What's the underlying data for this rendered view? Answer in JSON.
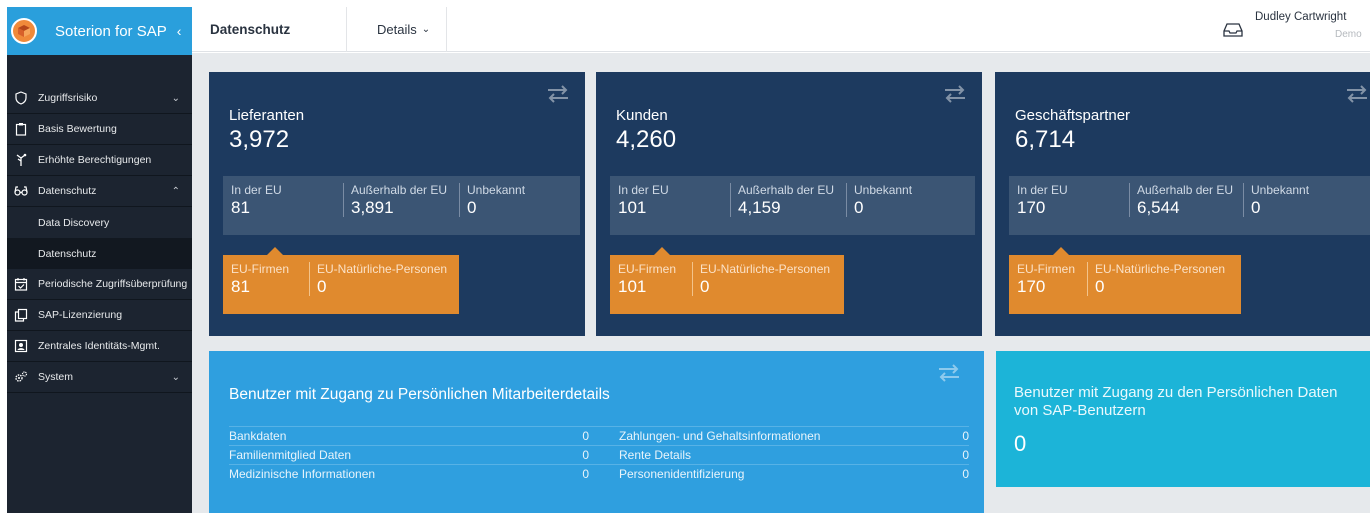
{
  "app": {
    "title": "Soterion for SAP",
    "collapse_glyph": "‹"
  },
  "sidebar": {
    "items": [
      {
        "label": "Zugriffsrisiko",
        "icon": "shield-icon",
        "arrow": "⌄"
      },
      {
        "label": "Basis Bewertung",
        "icon": "clipboard-icon"
      },
      {
        "label": "Erhöhte Berechtigungen",
        "icon": "tree-icon"
      },
      {
        "label": "Datenschutz",
        "icon": "glasses-icon",
        "arrow": "⌃"
      },
      {
        "label": "Periodische Zugriffsüberprüfung",
        "icon": "calendar-check-icon"
      },
      {
        "label": "SAP-Lizenzierung",
        "icon": "copy-icon"
      },
      {
        "label": "Zentrales Identitäts-Mgmt.",
        "icon": "id-card-icon"
      },
      {
        "label": "System",
        "icon": "gears-icon",
        "arrow": "⌄"
      }
    ],
    "subitems": [
      {
        "label": "Data Discovery"
      },
      {
        "label": "Datenschutz"
      }
    ]
  },
  "topbar": {
    "title": "Datenschutz",
    "details_label": "Details",
    "details_chevron": "⌄",
    "user_name": "Dudley Cartwright",
    "user_role": "Demo"
  },
  "cards": [
    {
      "label": "Lieferanten",
      "total": "3,972",
      "in_eu_label": "In der EU",
      "in_eu": "81",
      "outside_eu_label": "Außerhalb der EU",
      "outside_eu": "3,891",
      "unknown_label": "Unbekannt",
      "unknown": "0",
      "eu_firms_label": "EU-Firmen",
      "eu_firms": "81",
      "eu_persons_label": "EU-Natürliche-Personen",
      "eu_persons": "0"
    },
    {
      "label": "Kunden",
      "total": "4,260",
      "in_eu_label": "In der EU",
      "in_eu": "101",
      "outside_eu_label": "Außerhalb der EU",
      "outside_eu": "4,159",
      "unknown_label": "Unbekannt",
      "unknown": "0",
      "eu_firms_label": "EU-Firmen",
      "eu_firms": "101",
      "eu_persons_label": "EU-Natürliche-Personen",
      "eu_persons": "0"
    },
    {
      "label": "Geschäftspartner",
      "total": "6,714",
      "in_eu_label": "In der EU",
      "in_eu": "170",
      "outside_eu_label": "Außerhalb der EU",
      "outside_eu": "6,544",
      "unknown_label": "Unbekannt",
      "unknown": "0",
      "eu_firms_label": "EU-Firmen",
      "eu_firms": "170",
      "eu_persons_label": "EU-Natürliche-Personen",
      "eu_persons": "0"
    }
  ],
  "employee_panel": {
    "title": "Benutzer mit Zugang zu Persönlichen Mitarbeiterdetails",
    "rows": [
      {
        "left_label": "Bankdaten",
        "left_value": "0",
        "right_label": "Zahlungen- und Gehaltsinformationen",
        "right_value": "0"
      },
      {
        "left_label": "Familienmitglied Daten",
        "left_value": "0",
        "right_label": "Rente Details",
        "right_value": "0"
      },
      {
        "left_label": "Medizinische Informationen",
        "left_value": "0",
        "right_label": "Personenidentifizierung",
        "right_value": "0"
      }
    ]
  },
  "sap_users_panel": {
    "title": "Benutzer mit Zugang zu den Persönlichen Daten von SAP-Benutzern",
    "value": "0"
  },
  "colors": {
    "sidebar_bg": "#1c2430",
    "brand_bg": "#2a9fdc",
    "card_bg": "#1d3a5f",
    "card_breakdown_bg": "#3b5574",
    "eu_orange": "#e08a2e",
    "panel_blue": "#2f9fdf",
    "panel_cyan": "#1cb4d8",
    "content_bg": "#e6e9ec"
  }
}
